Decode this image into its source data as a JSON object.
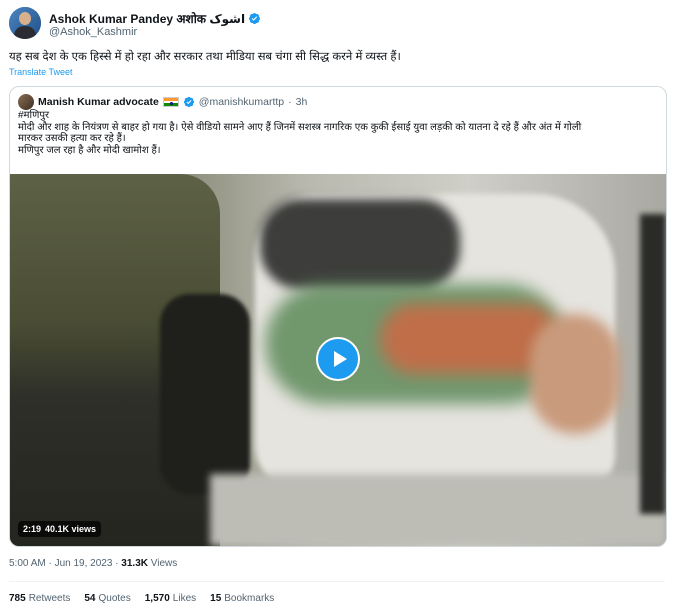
{
  "author": {
    "display_name": "Ashok Kumar Pandey अशोक اشوک",
    "handle": "@Ashok_Kashmir",
    "verified_icon": "verified-badge-icon"
  },
  "tweet": {
    "text": "यह सब देश के एक हिस्से में हो रहा और सरकार तथा मीडिया सब चंगा सी सिद्ध करने में व्यस्त हैं।",
    "translate_label": "Translate Tweet"
  },
  "quoted": {
    "display_name": "Manish Kumar advocate",
    "flag_icon": "india-flag-icon",
    "handle": "@manishkumarttp",
    "time": "3h",
    "lines": [
      "#मणिपुर",
      "मोदी और शाह के नियंत्रण से बाहर हो गया है।  ऐसे वीडियो सामने आए हैं जिनमें सशस्त्र नागरिक एक कुकी ईसाई युवा लड़की को यातना दे रहे हैं और अंत में गोली",
      "मारकर उसकी हत्या कर रहे हैं।",
      " मणिपुर जल रहा है और मोदी खामोश हैं।"
    ],
    "video": {
      "duration": "2:19",
      "views": "40.1K views",
      "play_icon": "play-icon"
    }
  },
  "meta": {
    "time": "5:00 AM · Jun 19, 2023 · ",
    "views_count": "31.3K",
    "views_label": " Views"
  },
  "stats": [
    {
      "count": "785",
      "label": "Retweets"
    },
    {
      "count": "54",
      "label": "Quotes"
    },
    {
      "count": "1,570",
      "label": "Likes"
    },
    {
      "count": "15",
      "label": "Bookmarks"
    }
  ],
  "colors": {
    "accent": "#1d9bf0",
    "text_secondary": "#536471",
    "border": "#cfd9de"
  }
}
